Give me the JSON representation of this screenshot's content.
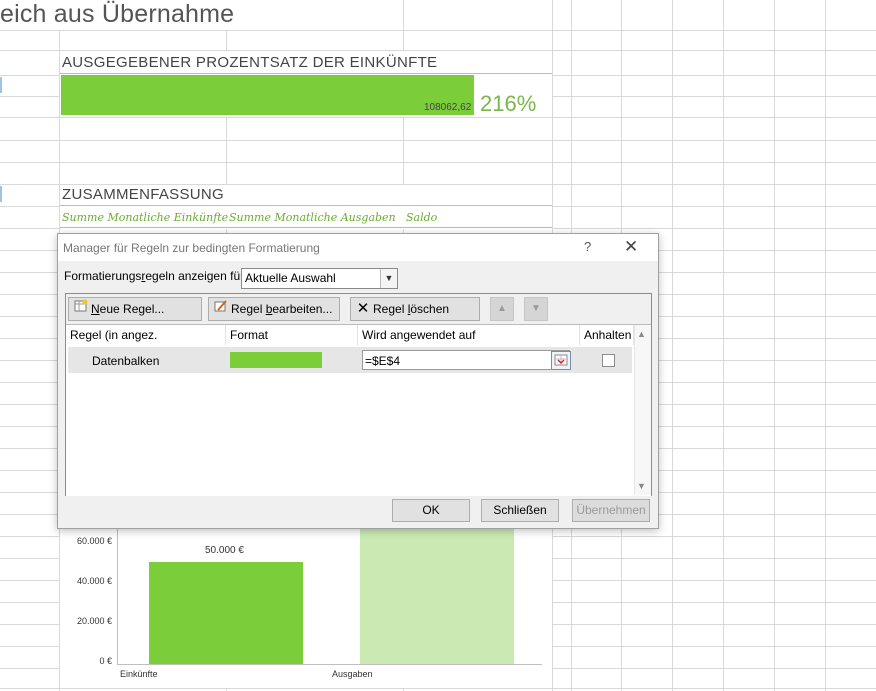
{
  "sheet": {
    "title": "eich aus Übernahme",
    "spent_section_title": "AUSGEGEBENER PROZENTSATZ DER EINKÜNFTE",
    "databar_value": "108062,62",
    "percent": "216%",
    "summary_title": "ZUSAMMENFASSUNG",
    "summary_headers": [
      "Summe Monatliche Einkünfte",
      "Summe Monatliche Ausgaben",
      "Saldo"
    ]
  },
  "chart": {
    "y_ticks": [
      "60.000 €",
      "40.000 €",
      "20.000 €",
      "0 €"
    ],
    "categories": [
      "Einkünfte",
      "Ausgaben"
    ],
    "data_labels": [
      "50.000 €"
    ]
  },
  "chart_data": {
    "type": "bar",
    "categories": [
      "Einkünfte",
      "Ausgaben"
    ],
    "values": [
      50000,
      108062.62
    ],
    "title": "",
    "xlabel": "",
    "ylabel": "",
    "ylim": [
      0,
      60000
    ],
    "data_labels": [
      "50.000 €"
    ],
    "colors": [
      "#7bce3a",
      "#cbeab2"
    ]
  },
  "dialog": {
    "title": "Manager für Regeln zur bedingten Formatierung",
    "help": "?",
    "close": "✕",
    "show_rules_label_pre": "Formatierungs",
    "show_rules_label_u": "r",
    "show_rules_label_post": "egeln anzeigen für:",
    "scope_value": "Aktuelle Auswahl",
    "toolbar": {
      "new_rule_u": "N",
      "new_rule_rest": "eue Regel...",
      "edit_rule_pre": "Regel ",
      "edit_rule_u": "b",
      "edit_rule_rest": "earbeiten...",
      "delete_rule_pre": "Regel ",
      "delete_rule_u": "l",
      "delete_rule_rest": "öschen"
    },
    "columns": [
      "Regel (in angez. Reihenfolge)",
      "Format",
      "Wird angewendet auf",
      "Anhalten"
    ],
    "rules": [
      {
        "name": "Datenbalken",
        "format_color": "#7bce3a",
        "applies_to": "=$E$4",
        "stop": false
      }
    ],
    "buttons": {
      "ok": "OK",
      "close": "Schließen",
      "apply": "Übernehmen"
    }
  }
}
